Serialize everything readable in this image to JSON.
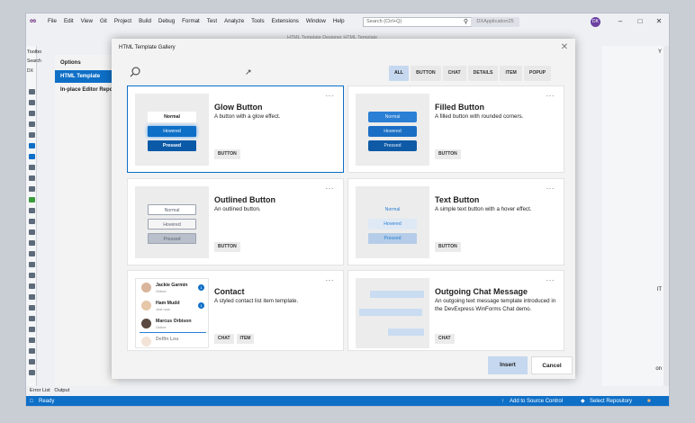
{
  "menubar": {
    "items": [
      "File",
      "Edit",
      "View",
      "Git",
      "Project",
      "Build",
      "Debug",
      "Format",
      "Test",
      "Analyze",
      "Tools",
      "Extensions",
      "Window",
      "Help"
    ],
    "search_placeholder": "Search (Ctrl+Q)",
    "app_name": "DXApplication25",
    "user_initials": "DK"
  },
  "editor_title": "HTML Template Designer HTML Template",
  "toolbox": {
    "label": "Toolbo",
    "search": "Search",
    "node": "DX"
  },
  "options": {
    "title": "Options",
    "selected": "HTML Template",
    "item": "In-place Editor Repo"
  },
  "dialog": {
    "title": "HTML Template Gallery",
    "filters": [
      "ALL",
      "BUTTON",
      "CHAT",
      "DETAILS",
      "ITEM",
      "POPUP"
    ],
    "active_filter": "ALL",
    "cards": [
      {
        "title": "Glow Button",
        "description": "A button with a glow effect.",
        "tags": [
          "BUTTON"
        ],
        "states": [
          "Normal",
          "Hovered",
          "Pressed"
        ]
      },
      {
        "title": "Filled Button",
        "description": "A filled button with rounded corners.",
        "tags": [
          "BUTTON"
        ],
        "states": [
          "Normal",
          "Hovered",
          "Pressed"
        ]
      },
      {
        "title": "Outlined Button",
        "description": "An outlined button.",
        "tags": [
          "BUTTON"
        ],
        "states": [
          "Normal",
          "Hovered",
          "Pressed"
        ]
      },
      {
        "title": "Text Button",
        "description": "A simple text button with a hover effect.",
        "tags": [
          "BUTTON"
        ],
        "states": [
          "Normal",
          "Hovered",
          "Pressed"
        ]
      },
      {
        "title": "Contact",
        "description": "A styled contact list item template.",
        "tags": [
          "CHAT",
          "ITEM"
        ],
        "contacts": [
          {
            "name": "Jackie Garmin",
            "status": "Online",
            "badge": "1"
          },
          {
            "name": "Ham Mudd",
            "status": "Just now",
            "badge": "1"
          },
          {
            "name": "Marcus Orbison",
            "status": "Online",
            "badge": ""
          },
          {
            "name": "Delfin Lou",
            "status": "",
            "badge": ""
          }
        ]
      },
      {
        "title": "Outgoing Chat Message",
        "description": "An outgoing text message template introduced in the DevExpress WinForms Chat demo.",
        "tags": [
          "CHAT"
        ]
      }
    ],
    "insert_label": "Insert",
    "cancel_label": "Cancel"
  },
  "right_panel": {
    "label_top": "Y",
    "label_mid": "IT",
    "label_bot": "on"
  },
  "error_tabs": [
    "Error List",
    "Output"
  ],
  "statusbar": {
    "ready": "Ready",
    "source_control": "Add to Source Control",
    "repository": "Select Repository"
  },
  "colors": {
    "accent": "#0e6fc7",
    "filter_active": "#c6d8ef"
  }
}
